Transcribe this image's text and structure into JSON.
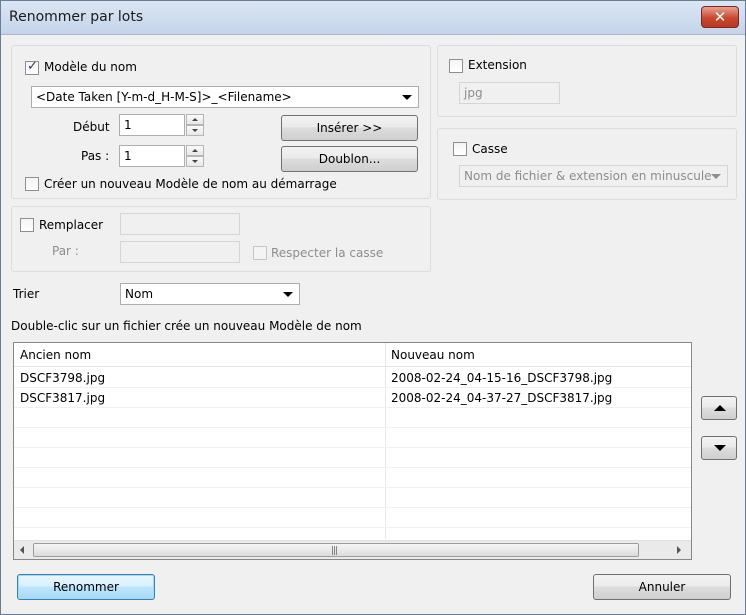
{
  "window": {
    "title": "Renommer par lots",
    "close_label": "✕"
  },
  "name_model": {
    "label": "Modèle du nom",
    "checked": true,
    "pattern": "<Date Taken [Y-m-d_H-M-S]>_<Filename>",
    "start_label": "Début",
    "start_value": "1",
    "step_label": "Pas :",
    "step_value": "1",
    "insert_button": "Insérer >>",
    "duplicate_button": "Doublon...",
    "create_new_label": "Créer un nouveau Modèle de nom au démarrage"
  },
  "extension": {
    "label": "Extension",
    "value": "jpg"
  },
  "case": {
    "label": "Casse",
    "value": "Nom de fichier & extension en minuscule"
  },
  "replace": {
    "label": "Remplacer",
    "by_label": "Par :",
    "match_case_label": "Respecter la casse",
    "find_value": "",
    "replace_value": ""
  },
  "sort": {
    "label": "Trier",
    "value": "Nom"
  },
  "hint": "Double-clic sur un fichier crée un nouveau Modèle de nom",
  "table": {
    "columns": [
      "Ancien nom",
      "Nouveau nom"
    ],
    "rows": [
      {
        "old": "DSCF3798.jpg",
        "new": "2008-02-24_04-15-16_DSCF3798.jpg"
      },
      {
        "old": "DSCF3817.jpg",
        "new": "2008-02-24_04-37-27_DSCF3817.jpg"
      }
    ]
  },
  "icons": {
    "move_up": "arrow-up-icon",
    "move_down": "arrow-down-icon",
    "scroll_grip": "|||"
  },
  "footer": {
    "rename_button": "Renommer",
    "cancel_button": "Annuler"
  }
}
